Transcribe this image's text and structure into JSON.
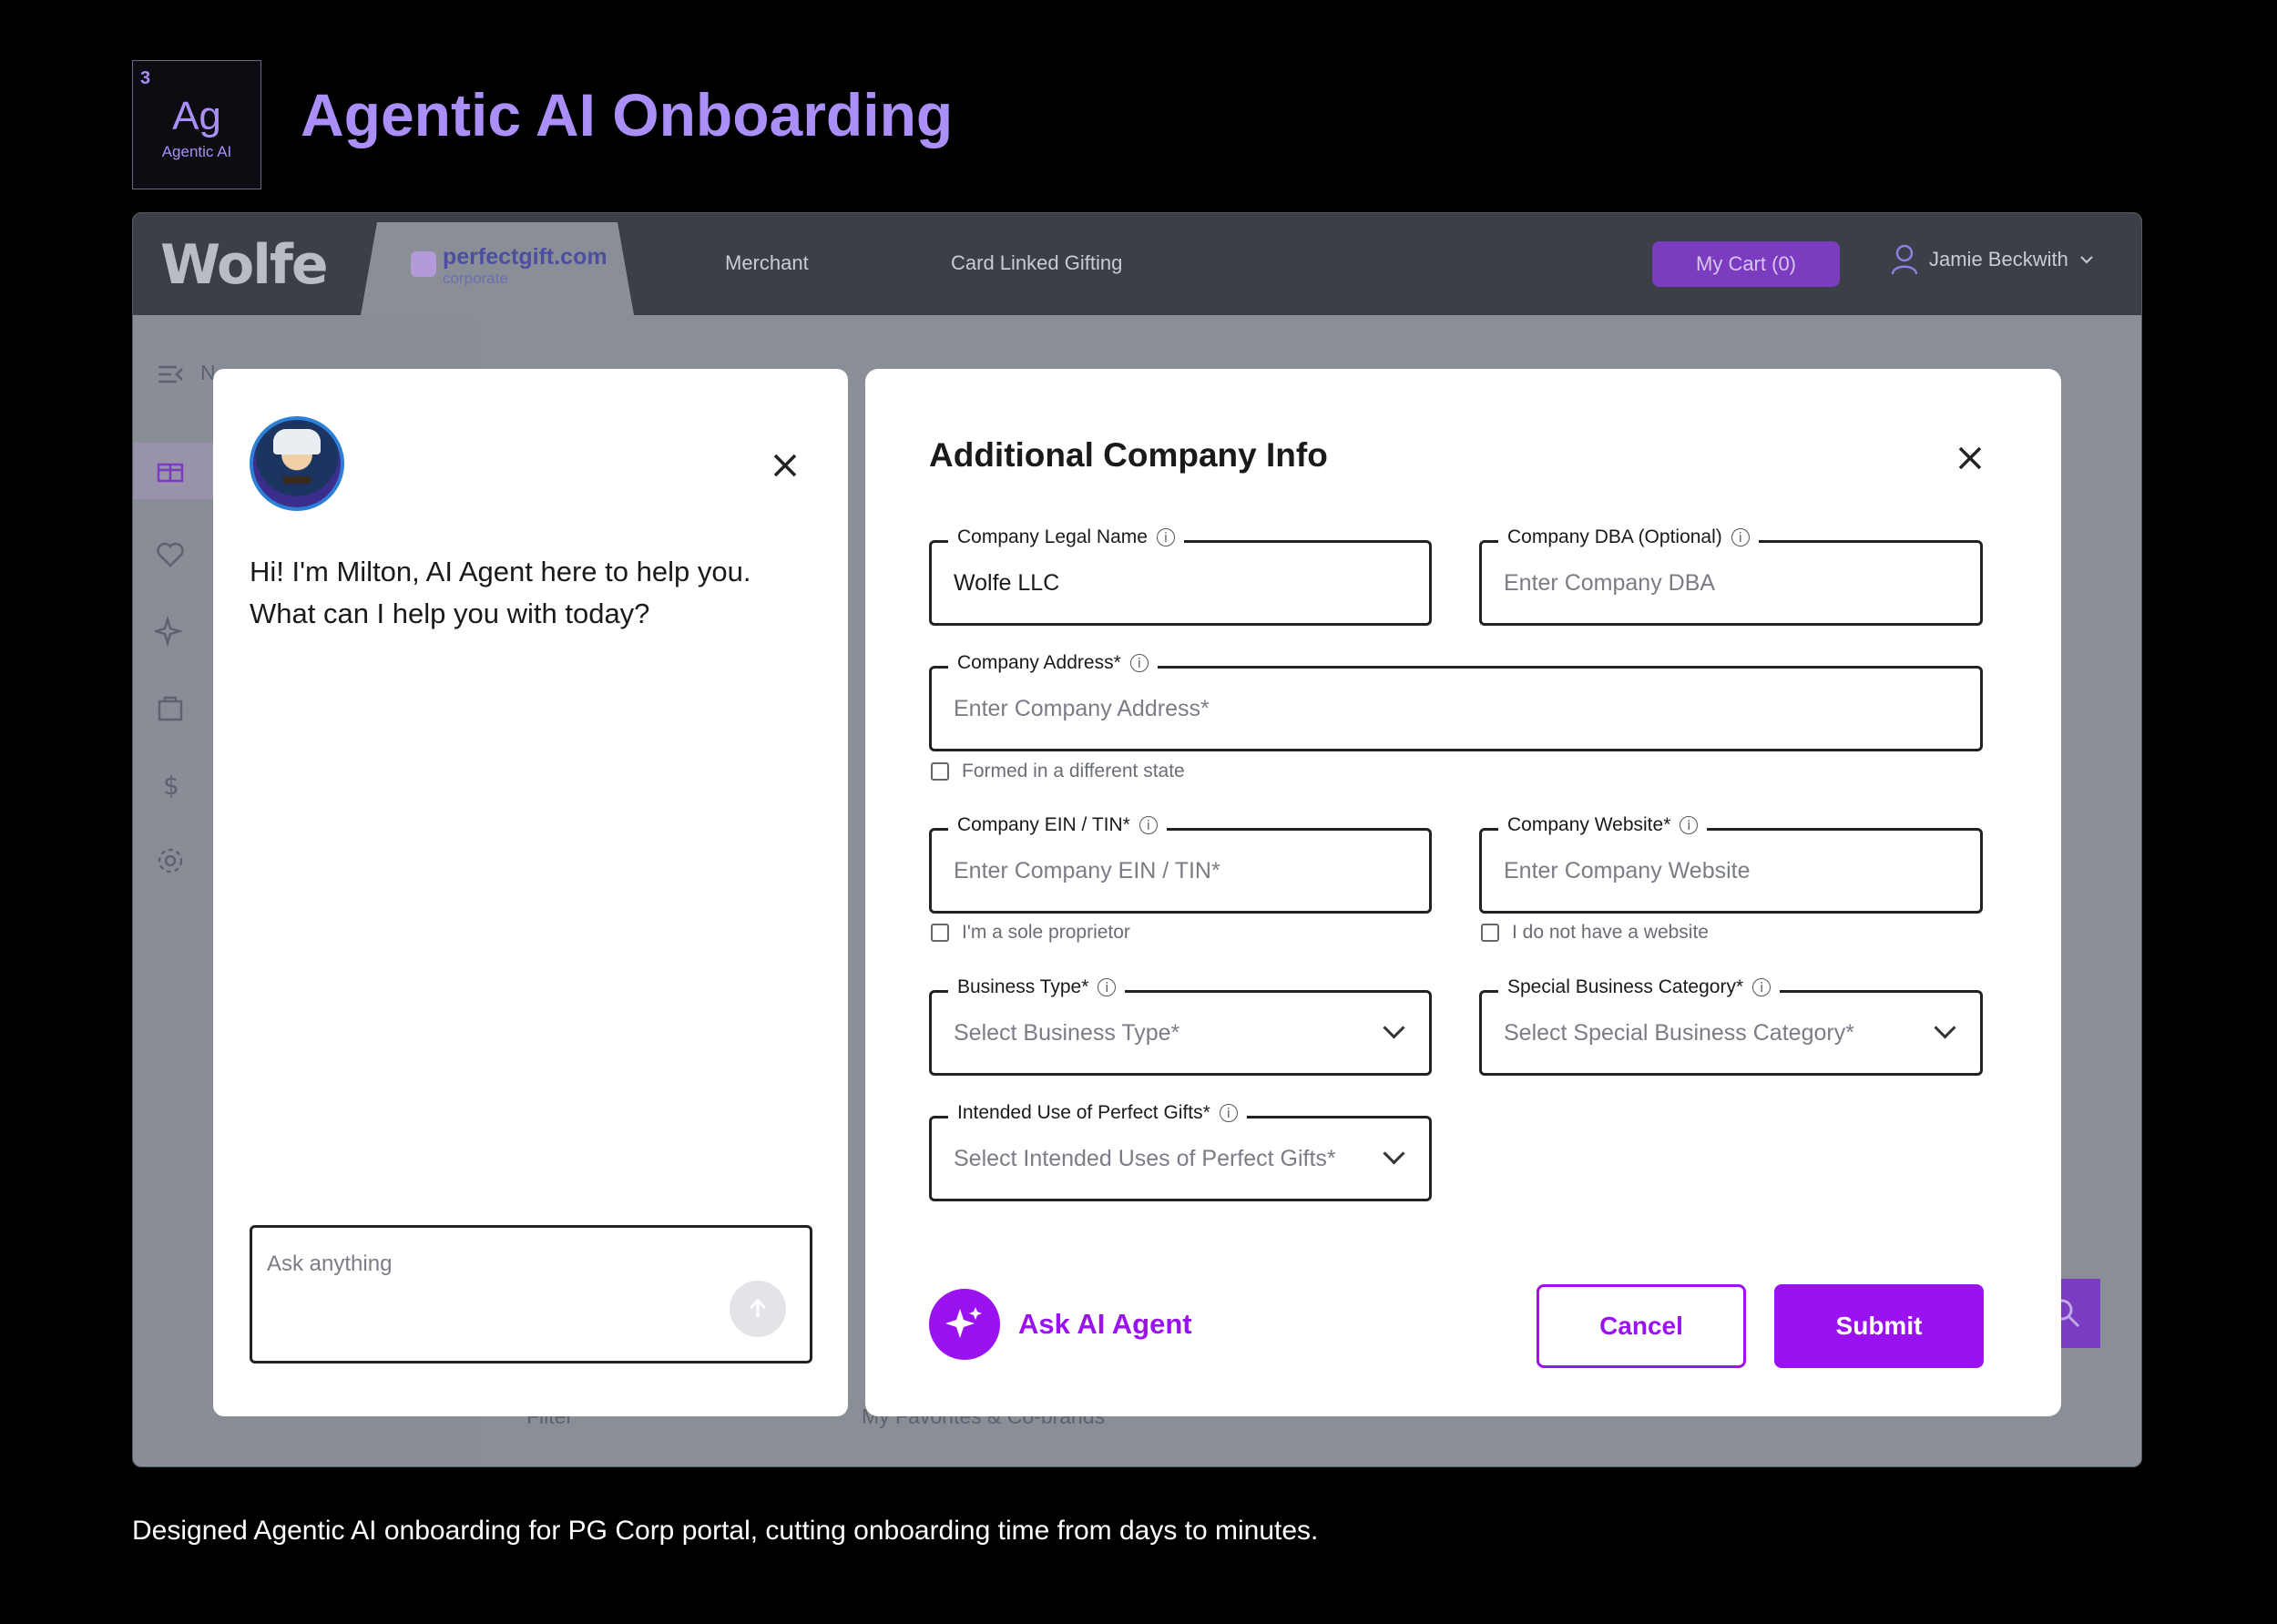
{
  "header": {
    "badge_number": "3",
    "badge_symbol": "Ag",
    "badge_caption": "Agentic AI",
    "title": "Agentic AI Onboarding"
  },
  "app": {
    "logo": "Wolfe",
    "portal_name": "perfectgift.com",
    "portal_sub": "corporate",
    "nav_links": [
      "Merchant",
      "Card Linked Gifting"
    ],
    "cart_label": "My Cart (0)",
    "user_name": "Jamie Beckwith",
    "background_snippets": [
      "N",
      "Filter",
      "My Favorites & Co-brands"
    ]
  },
  "chat": {
    "message": "Hi! I'm Milton, AI Agent here to help you. What can I help you with today?",
    "input_placeholder": "Ask anything"
  },
  "form": {
    "title": "Additional Company Info",
    "fields": {
      "legal_name": {
        "label": "Company Legal Name",
        "value": "Wolfe LLC"
      },
      "dba": {
        "label": "Company DBA (Optional)",
        "placeholder": "Enter Company DBA"
      },
      "address": {
        "label": "Company Address*",
        "placeholder": "Enter Company Address*"
      },
      "ein": {
        "label": "Company EIN / TIN*",
        "placeholder": "Enter Company EIN / TIN*"
      },
      "website": {
        "label": "Company Website*",
        "placeholder": "Enter Company Website"
      },
      "business_type": {
        "label": "Business Type*",
        "placeholder": "Select Business Type*"
      },
      "special_category": {
        "label": "Special Business Category*",
        "placeholder": "Select Special Business Category*"
      },
      "intended_use": {
        "label": "Intended Use of Perfect Gifts*",
        "placeholder": "Select Intended Uses of Perfect Gifts*"
      }
    },
    "checkboxes": {
      "different_state": "Formed in a different state",
      "sole_proprietor": "I'm a sole proprietor",
      "no_website": "I do not have a website"
    },
    "ask_ai_label": "Ask AI Agent",
    "cancel_label": "Cancel",
    "submit_label": "Submit"
  },
  "caption": "Designed Agentic AI onboarding for PG Corp portal, cutting onboarding time from days to minutes.",
  "colors": {
    "accent": "#9a12f0",
    "title_purple": "#a98ff7",
    "navbar": "#3a3f48"
  }
}
